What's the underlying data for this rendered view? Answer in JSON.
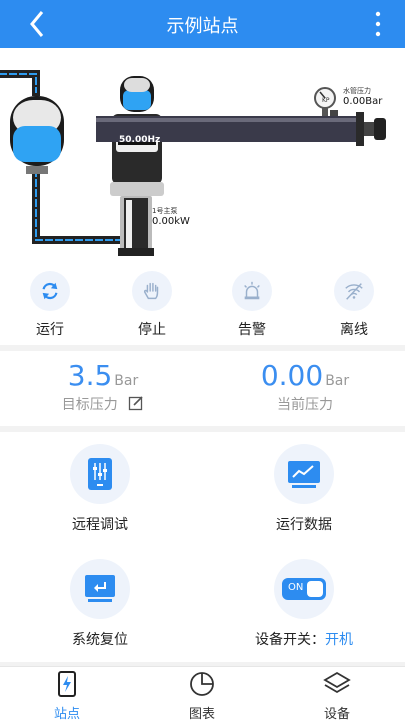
{
  "header": {
    "title": "示例站点"
  },
  "diagram": {
    "frequency": "50.00Hz",
    "pump_label": "1号主泵",
    "pump_power": "0.00kW",
    "gauge_label": "水管压力",
    "gauge_value": "0.00Bar",
    "gauge_unit": "KP"
  },
  "status": [
    {
      "label": "运行",
      "icon": "sync-icon"
    },
    {
      "label": "停止",
      "icon": "hand-stop-icon"
    },
    {
      "label": "告警",
      "icon": "alarm-light-icon"
    },
    {
      "label": "离线",
      "icon": "wifi-off-icon"
    }
  ],
  "pressure": {
    "target_value": "3.5",
    "target_unit": "Bar",
    "target_label": "目标压力",
    "current_value": "0.00",
    "current_unit": "Bar",
    "current_label": "当前压力"
  },
  "functions": {
    "remote_debug": "远程调试",
    "run_data": "运行数据",
    "system_reset": "系统复位",
    "device_switch_label": "设备开关：",
    "device_switch_state": "开机",
    "toggle_text": "ON"
  },
  "tabbar": [
    {
      "label": "站点",
      "icon": "station-icon",
      "active": true
    },
    {
      "label": "图表",
      "icon": "pie-chart-icon",
      "active": false
    },
    {
      "label": "设备",
      "icon": "layers-icon",
      "active": false
    }
  ],
  "colors": {
    "primary": "#2d8cf0",
    "value_blue": "#3b8ef0",
    "icon_bg": "#eef3fb"
  }
}
